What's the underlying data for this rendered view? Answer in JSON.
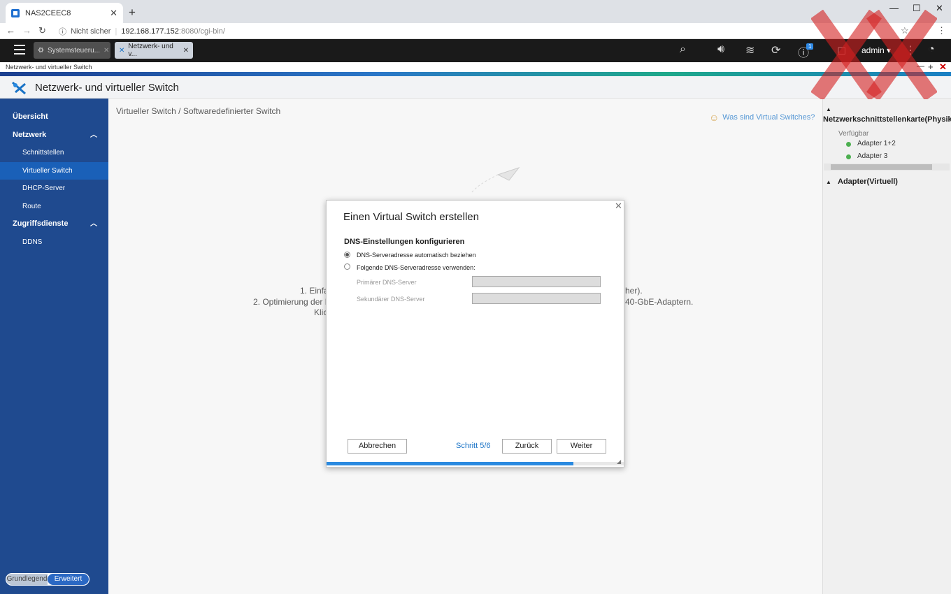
{
  "browser": {
    "tab_title": "NAS2CEEC8",
    "security": "Nicht sicher",
    "url_host": "192.168.177.152",
    "url_path": ":8080/cgi-bin/"
  },
  "qnap_bar": {
    "tabs": [
      {
        "label": "Systemsteueru..."
      },
      {
        "label": "Netzwerk- und v..."
      }
    ],
    "notification_count": "1",
    "user": "admin ▾"
  },
  "window_strip_title": "Netzwerk- und virtueller Switch",
  "app": {
    "title": "Netzwerk- und virtueller Switch"
  },
  "sidebar": {
    "items": [
      {
        "label": "Übersicht"
      },
      {
        "label": "Netzwerk"
      },
      {
        "label": "Schnittstellen"
      },
      {
        "label": "Virtueller Switch"
      },
      {
        "label": "DHCP-Server"
      },
      {
        "label": "Route"
      },
      {
        "label": "Zugriffsdienste"
      },
      {
        "label": "DDNS"
      }
    ],
    "mode": {
      "basic": "Grundlegend",
      "advanced": "Erweitert"
    }
  },
  "main": {
    "breadcrumb": "Virtueller Switch / Softwaredefinierter Switch",
    "help_link": "Was sind Virtual Switches?",
    "bg_line1": "1. Einfa",
    "bg_line1_end": "her).",
    "bg_line2": "2. Optimierung der N",
    "bg_line2_end": "40-GbE-Adaptern.",
    "bg_line3": "Klic"
  },
  "right_panel": {
    "heading": "Netzwerkschnittstellenkarte(Physikalisch)",
    "available": "Verfügbar",
    "adapters": [
      "Adapter 1+2",
      "Adapter 3"
    ],
    "heading2": "Adapter(Virtuell)",
    "status_color": "#4caf50"
  },
  "dialog": {
    "title": "Einen Virtual Switch erstellen",
    "section": "DNS-Einstellungen konfigurieren",
    "option_auto": "DNS-Serveradresse automatisch beziehen",
    "option_manual": "Folgende DNS-Serveradresse verwenden:",
    "primary_label": "Primärer DNS-Server",
    "secondary_label": "Sekundärer DNS-Server",
    "cancel": "Abbrechen",
    "step": "Schritt 5/6",
    "back": "Zurück",
    "next": "Weiter",
    "progress": 0.83,
    "selected_option": "auto"
  },
  "colors": {
    "sidebar": "#1f4a8f",
    "accent": "#1a73c6",
    "watermark": "#d42020"
  }
}
